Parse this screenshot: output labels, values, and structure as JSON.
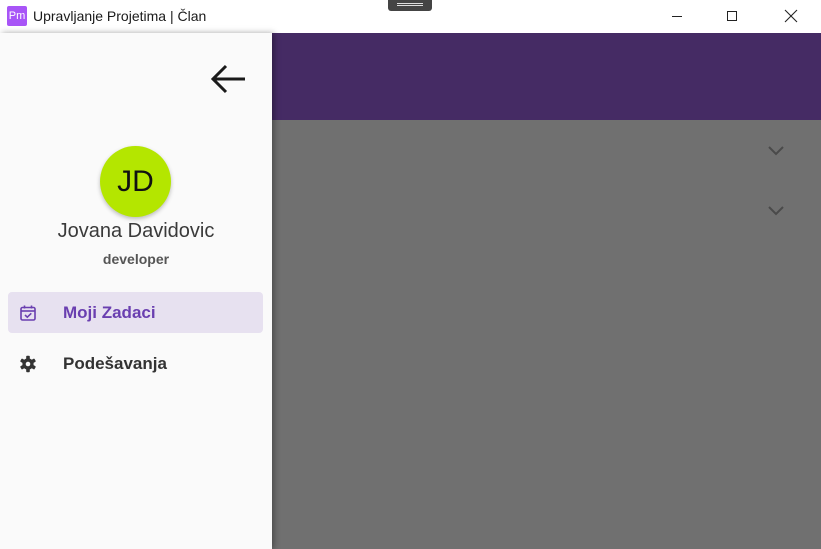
{
  "window": {
    "title": "Upravljanje Projetima | Član",
    "app_icon_text": "Pm"
  },
  "drawer": {
    "avatar_initials": "JD",
    "user_name": "Jovana Davidovic",
    "user_role": "developer",
    "nav_items": [
      {
        "label": "Moji Zadaci",
        "icon": "calendar-check-icon",
        "active": true
      },
      {
        "label": "Podešavanja",
        "icon": "gear-icon",
        "active": false
      }
    ]
  },
  "colors": {
    "appbar": "#452b64",
    "avatar": "#b4e600",
    "active_item_bg": "#e7e1f0",
    "active_item_text": "#6a3fb0",
    "scrim_content": "#707070"
  }
}
